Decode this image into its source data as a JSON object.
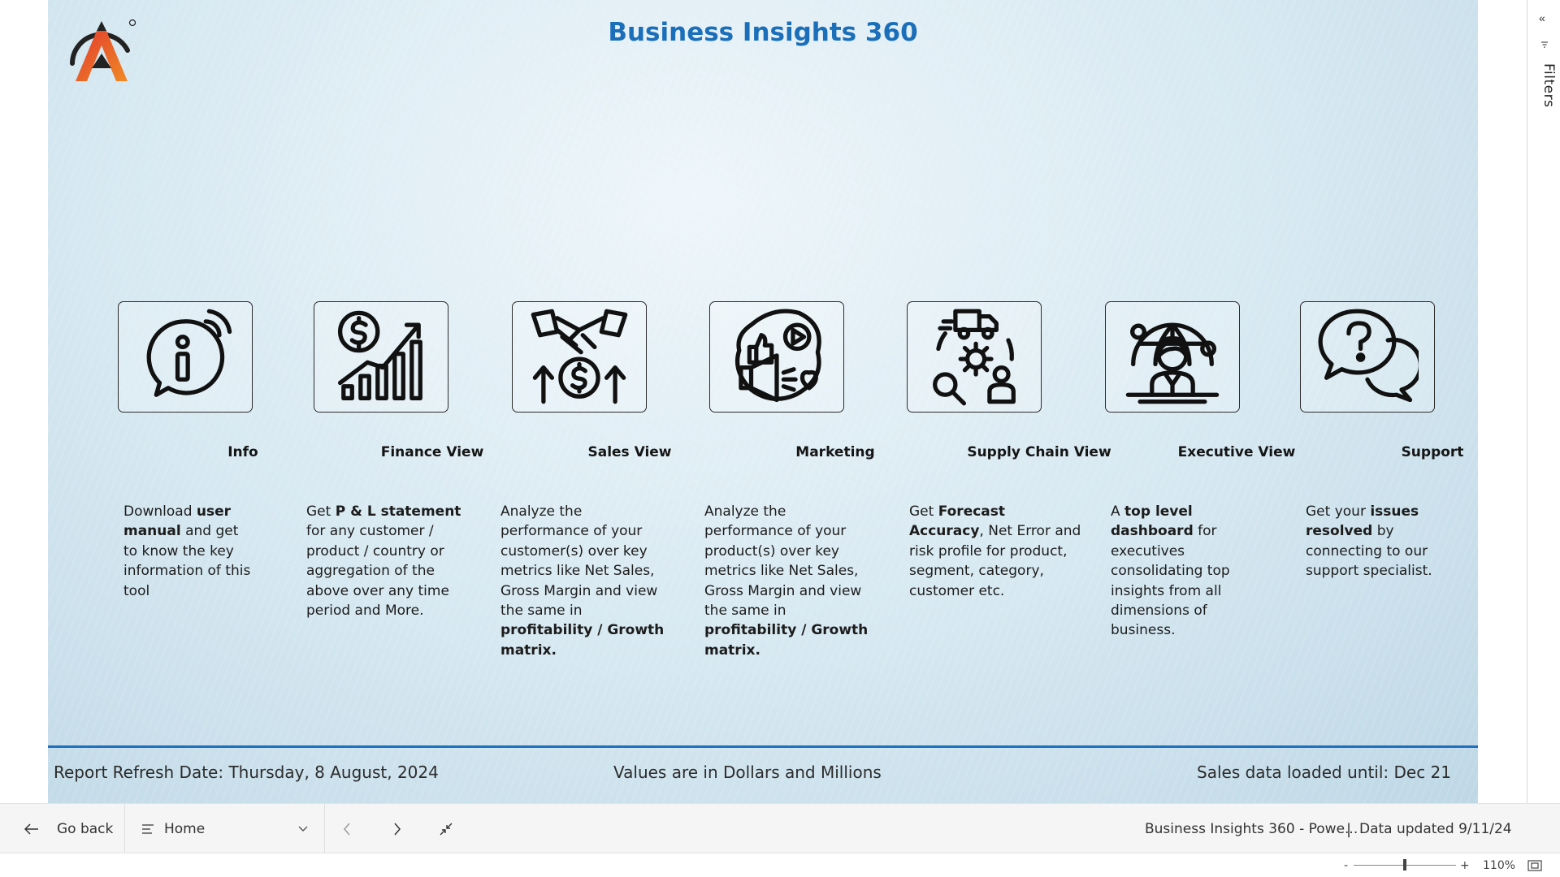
{
  "report": {
    "title": "Business Insights 360",
    "cards": [
      {
        "icon": "info-icon",
        "title": "Info",
        "desc": [
          {
            "t": "Download ",
            "b": false
          },
          {
            "t": "user manual",
            "b": true
          },
          {
            "t": " and get to know the key information of this tool",
            "b": false
          }
        ]
      },
      {
        "icon": "finance-growth-icon",
        "title": "Finance View",
        "desc": [
          {
            "t": "Get  ",
            "b": false
          },
          {
            "t": "P & L statement",
            "b": true
          },
          {
            "t": " for any customer / product / country or aggregation of the above over any time period and More.",
            "b": false
          }
        ]
      },
      {
        "icon": "handshake-icon",
        "title": "Sales View",
        "desc": [
          {
            "t": "Analyze the performance of your customer(s) over key metrics like Net Sales, Gross Margin and view the same in ",
            "b": false
          },
          {
            "t": "profitability / Growth matrix.",
            "b": true
          }
        ]
      },
      {
        "icon": "marketing-megaphone-icon",
        "title": "Marketing",
        "desc": [
          {
            "t": "Analyze the performance of your product(s) over key metrics like Net Sales, Gross Margin and view the same in ",
            "b": false
          },
          {
            "t": "profitability / Growth matrix.",
            "b": true
          }
        ]
      },
      {
        "icon": "supply-chain-icon",
        "title": "Supply Chain View",
        "desc": [
          {
            "t": "Get ",
            "b": false
          },
          {
            "t": "Forecast Accuracy",
            "b": true
          },
          {
            "t": ", Net Error and risk profile for product, segment, category, customer etc.",
            "b": false
          }
        ]
      },
      {
        "icon": "executive-globe-icon",
        "title": "Executive View",
        "desc": [
          {
            "t": "A ",
            "b": false
          },
          {
            "t": "top level dashboard",
            "b": true
          },
          {
            "t": " for executives consolidating top insights from all dimensions of business.",
            "b": false
          }
        ]
      },
      {
        "icon": "support-chat-icon",
        "title": "Support",
        "desc": [
          {
            "t": "Get your ",
            "b": false
          },
          {
            "t": "issues resolved",
            "b": true
          },
          {
            "t": " by connecting to our support specialist.",
            "b": false
          }
        ]
      }
    ],
    "footer": {
      "refresh": "Report Refresh Date:  Thursday, 8 August, 2024",
      "units": "Values are in Dollars and Millions",
      "loaded": "Sales data loaded until: Dec 21"
    },
    "colors": {
      "title": "#1b6fba",
      "rule": "#1e6fbd",
      "logo_red": "#e23b2e",
      "logo_orange": "#f08a24"
    }
  },
  "filters": {
    "label": "Filters",
    "collapse_icon": "chevrons-left-icon"
  },
  "navbar": {
    "back_label": "Go back",
    "page_label": "Home",
    "report_name": "Business Insights 360 - Powe...",
    "data_updated": "Data updated 9/11/24"
  },
  "statusbar": {
    "zoom_minus": "-",
    "zoom_plus": "+",
    "zoom_level": "110%",
    "zoom_fraction": 0.5
  }
}
